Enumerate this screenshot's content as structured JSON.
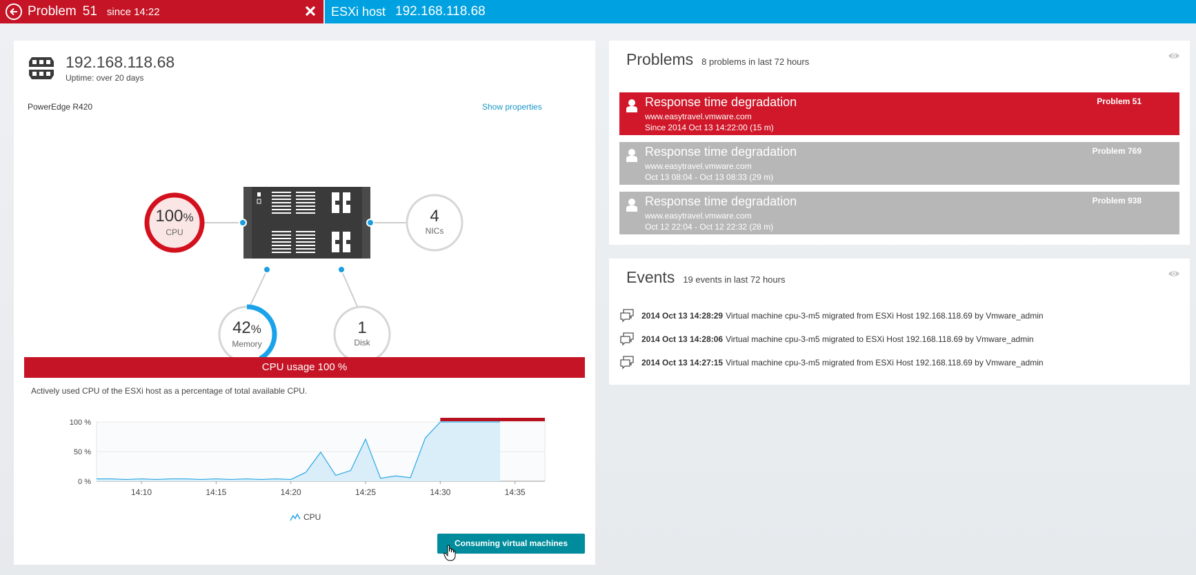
{
  "topbar": {
    "problem_word": "Problem",
    "problem_number": "51",
    "problem_since": "since 14:22",
    "host_label": "ESXi host",
    "host_ip": "192.168.118.68"
  },
  "host": {
    "ip": "192.168.118.68",
    "uptime": "Uptime: over 20 days",
    "model": "PowerEdge R420",
    "show_properties": "Show properties"
  },
  "metrics": {
    "cpu": {
      "value": "100",
      "unit": "%",
      "label": "CPU",
      "fraction": 1.0
    },
    "nics": {
      "value": "4",
      "label": "NICs"
    },
    "memory": {
      "value": "42",
      "unit": "%",
      "label": "Memory",
      "fraction": 0.42
    },
    "disk": {
      "value": "1",
      "label": "Disk"
    }
  },
  "cpu_panel": {
    "banner": "CPU usage 100 %",
    "description": "Actively used CPU of the ESXi host as a percentage of total available CPU.",
    "legend": "CPU",
    "button": "Consuming virtual machines"
  },
  "chart_data": {
    "type": "area",
    "title": "CPU usage 100 %",
    "xlabel": "",
    "ylabel": "",
    "y_ticks": [
      "0 %",
      "50 %",
      "100 %"
    ],
    "x_ticks": [
      "14:10",
      "14:15",
      "14:20",
      "14:25",
      "14:30",
      "14:35"
    ],
    "ylim": [
      0,
      100
    ],
    "series": [
      {
        "name": "CPU",
        "x": [
          "14:07",
          "14:08",
          "14:09",
          "14:10",
          "14:11",
          "14:12",
          "14:13",
          "14:14",
          "14:15",
          "14:16",
          "14:17",
          "14:18",
          "14:19",
          "14:20",
          "14:21",
          "14:22",
          "14:23",
          "14:24",
          "14:25",
          "14:26",
          "14:27",
          "14:28",
          "14:29",
          "14:30",
          "14:31",
          "14:32",
          "14:33",
          "14:34"
        ],
        "values": [
          4,
          4,
          3,
          4,
          3,
          4,
          4,
          3,
          4,
          3,
          4,
          3,
          4,
          3,
          15,
          49,
          10,
          18,
          71,
          5,
          9,
          6,
          73,
          100,
          100,
          100,
          100,
          100
        ]
      }
    ],
    "problem_marker": {
      "from": "14:30",
      "to": "14:37"
    },
    "grid": true,
    "colors": {
      "line": "#29a6e6",
      "fill": "#d9eef9",
      "marker": "#b8101e"
    }
  },
  "problems": {
    "title": "Problems",
    "subtitle": "8 problems in last 72 hours",
    "items": [
      {
        "title": "Response time degradation",
        "url": "www.easytravel.vmware.com",
        "date": "Since 2014 Oct 13 14:22:00    (15 m)",
        "number": "Problem 51",
        "status": "open"
      },
      {
        "title": "Response time degradation",
        "url": "www.easytravel.vmware.com",
        "date": "Oct 13 08:04 - Oct 13 08:33    (29 m)",
        "number": "Problem 769",
        "status": "closed"
      },
      {
        "title": "Response time degradation",
        "url": "www.easytravel.vmware.com",
        "date": "Oct 12 22:04 - Oct 12 22:32    (28 m)",
        "number": "Problem 938",
        "status": "closed"
      }
    ]
  },
  "events": {
    "title": "Events",
    "subtitle": "19 events in last 72 hours",
    "items": [
      {
        "time": "2014 Oct 13 14:28:29",
        "text": "Virtual machine cpu-3-m5 migrated from ESXi Host 192.168.118.69 by Vmware_admin"
      },
      {
        "time": "2014 Oct 13 14:28:06",
        "text": "Virtual machine cpu-3-m5 migrated to ESXi Host 192.168.118.69 by Vmware_admin"
      },
      {
        "time": "2014 Oct 13 14:27:15",
        "text": "Virtual machine cpu-3-m5 migrated from ESXi Host 192.168.118.69 by Vmware_admin"
      }
    ]
  },
  "colors": {
    "problem_red": "#c41425",
    "host_blue": "#00a1e0",
    "teal_button": "#008c9c",
    "closed_gray": "#b7b7b7"
  }
}
